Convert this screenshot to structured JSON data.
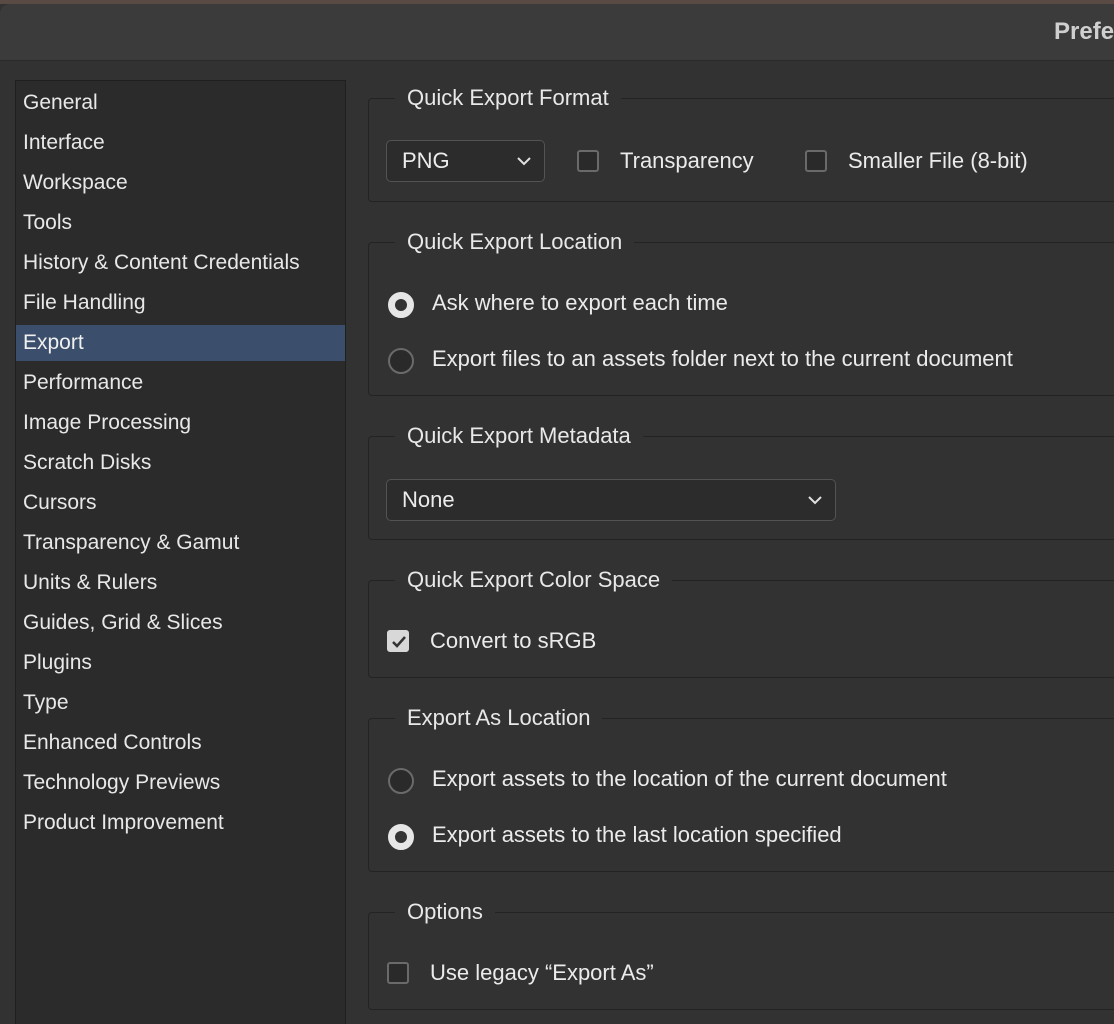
{
  "window": {
    "title": "Prefe"
  },
  "sidebar": {
    "items": [
      {
        "label": "General",
        "selected": false
      },
      {
        "label": "Interface",
        "selected": false
      },
      {
        "label": "Workspace",
        "selected": false
      },
      {
        "label": "Tools",
        "selected": false
      },
      {
        "label": "History & Content Credentials",
        "selected": false
      },
      {
        "label": "File Handling",
        "selected": false
      },
      {
        "label": "Export",
        "selected": true
      },
      {
        "label": "Performance",
        "selected": false
      },
      {
        "label": "Image Processing",
        "selected": false
      },
      {
        "label": "Scratch Disks",
        "selected": false
      },
      {
        "label": "Cursors",
        "selected": false
      },
      {
        "label": "Transparency & Gamut",
        "selected": false
      },
      {
        "label": "Units & Rulers",
        "selected": false
      },
      {
        "label": "Guides, Grid & Slices",
        "selected": false
      },
      {
        "label": "Plugins",
        "selected": false
      },
      {
        "label": "Type",
        "selected": false
      },
      {
        "label": "Enhanced Controls",
        "selected": false
      },
      {
        "label": "Technology Previews",
        "selected": false
      },
      {
        "label": "Product Improvement",
        "selected": false
      }
    ]
  },
  "quick_export_format": {
    "title": "Quick Export Format",
    "format_value": "PNG",
    "transparency": {
      "label": "Transparency",
      "checked": false
    },
    "smaller_file": {
      "label": "Smaller File (8-bit)",
      "checked": false
    }
  },
  "quick_export_location": {
    "title": "Quick Export Location",
    "options": [
      {
        "label": "Ask where to export each time",
        "selected": true
      },
      {
        "label": "Export files to an assets folder next to the current document",
        "selected": false
      }
    ]
  },
  "quick_export_metadata": {
    "title": "Quick Export Metadata",
    "value": "None"
  },
  "quick_export_color_space": {
    "title": "Quick Export Color Space",
    "convert_srgb": {
      "label": "Convert to sRGB",
      "checked": true
    }
  },
  "export_as_location": {
    "title": "Export As Location",
    "options": [
      {
        "label": "Export assets to the location of the current document",
        "selected": false
      },
      {
        "label": "Export assets to the last location specified",
        "selected": true
      }
    ]
  },
  "options": {
    "title": "Options",
    "legacy_export": {
      "label": "Use legacy “Export As”",
      "checked": false
    }
  },
  "colors": {
    "background": "#323232",
    "sidebar_bg": "#2b2b2b",
    "selected_item": "#3b4e6b",
    "text": "#e8e8e8"
  }
}
